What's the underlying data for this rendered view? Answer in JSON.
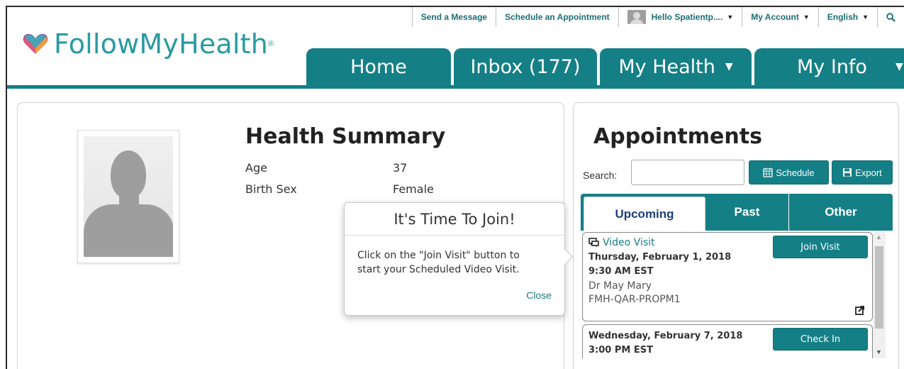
{
  "colors": {
    "brand_teal": "#157f86",
    "logo_teal": "#2a9aa2",
    "tab_text_active": "#1d3f7a"
  },
  "logo": {
    "text": "FollowMyHealth",
    "reg": "®"
  },
  "topbar": {
    "send_message": "Send a Message",
    "schedule_appointment": "Schedule an Appointment",
    "user_greeting": "Hello Spatientp....",
    "my_account": "My Account",
    "language": "English"
  },
  "nav": {
    "home": "Home",
    "inbox": "Inbox (177)",
    "my_health": "My Health",
    "my_info": "My Info"
  },
  "health_summary": {
    "title": "Health Summary",
    "age_label": "Age",
    "age_value": "37",
    "sex_label": "Birth Sex",
    "sex_value": "Female"
  },
  "popover": {
    "title": "It's Time To Join!",
    "line1": "Click on the \"Join Visit\" button to",
    "line2": "start your Scheduled Video Visit.",
    "close": "Close"
  },
  "appointments": {
    "title": "Appointments",
    "search_label": "Search:",
    "search_value": "",
    "schedule_btn": "Schedule",
    "export_btn": "Export",
    "tabs": {
      "upcoming": "Upcoming",
      "past": "Past",
      "other": "Other"
    },
    "items": [
      {
        "type": "Video Visit",
        "date": "Thursday, February 1, 2018",
        "time": "9:30 AM EST",
        "doctor": "Dr May Mary",
        "location": "FMH-QAR-PROPM1",
        "action": "Join Visit"
      },
      {
        "date": "Wednesday, February 7, 2018",
        "time": "3:00 PM EST",
        "action": "Check In"
      }
    ]
  },
  "icons": {
    "logo": "heart-icon",
    "search": "search-icon",
    "schedule": "calendar-icon",
    "export": "save-icon",
    "video": "video-chat-icon",
    "external": "external-link-icon"
  }
}
